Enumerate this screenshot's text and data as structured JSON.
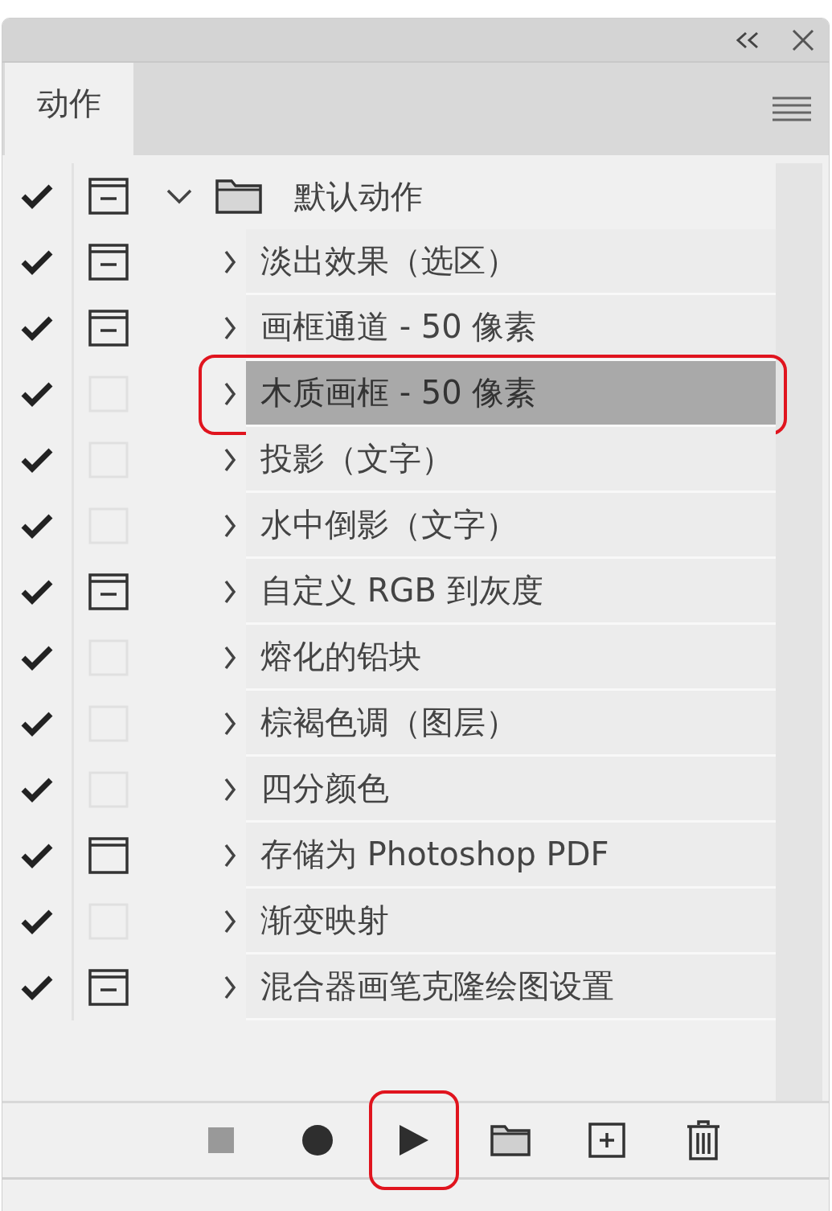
{
  "panel": {
    "tabs": [
      {
        "label": "动作",
        "selected": true
      }
    ]
  },
  "actions": {
    "set": {
      "name": "默认动作",
      "enabled": true,
      "dialog": true,
      "partial": true,
      "expanded": true
    },
    "items": [
      {
        "name": "淡出效果（选区）",
        "enabled": true,
        "dialog": true,
        "partial": true,
        "selected": false,
        "highlighted": false
      },
      {
        "name": "画框通道 - 50 像素",
        "enabled": true,
        "dialog": true,
        "partial": true,
        "selected": false,
        "highlighted": false
      },
      {
        "name": "木质画框 - 50 像素",
        "enabled": true,
        "dialog": false,
        "partial": false,
        "selected": true,
        "highlighted": true
      },
      {
        "name": "投影（文字）",
        "enabled": true,
        "dialog": false,
        "partial": false,
        "selected": false,
        "highlighted": false
      },
      {
        "name": "水中倒影（文字）",
        "enabled": true,
        "dialog": false,
        "partial": false,
        "selected": false,
        "highlighted": false
      },
      {
        "name": "自定义 RGB 到灰度",
        "enabled": true,
        "dialog": true,
        "partial": true,
        "selected": false,
        "highlighted": false
      },
      {
        "name": "熔化的铅块",
        "enabled": true,
        "dialog": false,
        "partial": false,
        "selected": false,
        "highlighted": false
      },
      {
        "name": "棕褐色调（图层）",
        "enabled": true,
        "dialog": false,
        "partial": false,
        "selected": false,
        "highlighted": false
      },
      {
        "name": "四分颜色",
        "enabled": true,
        "dialog": false,
        "partial": false,
        "selected": false,
        "highlighted": false
      },
      {
        "name": "存储为 Photoshop PDF",
        "enabled": true,
        "dialog": true,
        "partial": false,
        "selected": false,
        "highlighted": false
      },
      {
        "name": "渐变映射",
        "enabled": true,
        "dialog": false,
        "partial": false,
        "selected": false,
        "highlighted": false
      },
      {
        "name": "混合器画笔克隆绘图设置",
        "enabled": true,
        "dialog": true,
        "partial": true,
        "selected": false,
        "highlighted": false
      }
    ]
  },
  "toolbar": {
    "buttons": [
      {
        "kind": "stop",
        "highlighted": false
      },
      {
        "kind": "record",
        "highlighted": false
      },
      {
        "kind": "play",
        "highlighted": true
      },
      {
        "kind": "new-set",
        "highlighted": false
      },
      {
        "kind": "new-action",
        "highlighted": false
      },
      {
        "kind": "delete",
        "highlighted": false
      }
    ]
  }
}
